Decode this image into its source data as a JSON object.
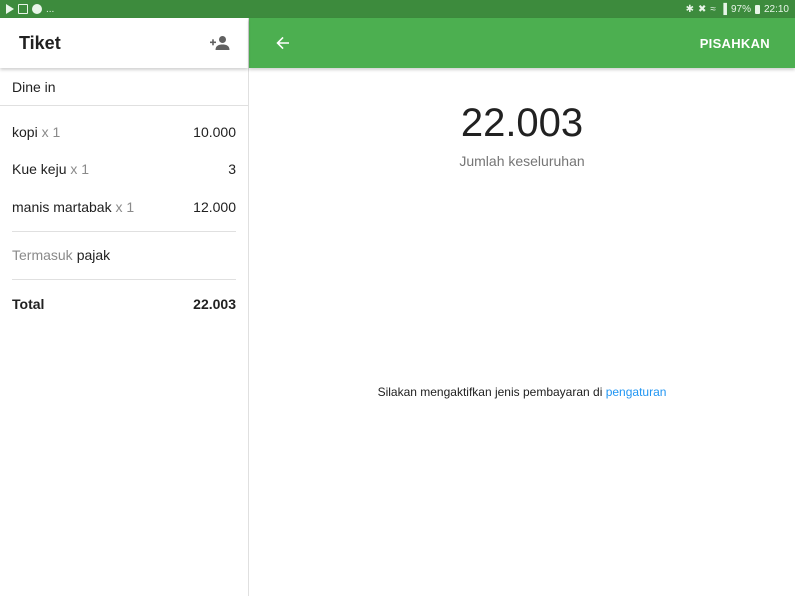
{
  "status_bar": {
    "left_more": "...",
    "battery": "97%",
    "time": "22:10"
  },
  "ticket": {
    "title": "Tiket",
    "dine_option": "Dine in",
    "items": [
      {
        "name": "kopi",
        "qty": "x 1",
        "price": "10.000"
      },
      {
        "name": "Kue keju",
        "qty": "x 1",
        "price": "3"
      },
      {
        "name": "manis martabak",
        "qty": "x 1",
        "price": "12.000"
      }
    ],
    "tax_prefix": "Termasuk",
    "tax_name": "pajak",
    "total_label": "Total",
    "total_value": "22.003"
  },
  "payment": {
    "split_label": "PISAHKAN",
    "amount": "22.003",
    "amount_label": "Jumlah keseluruhan",
    "notice_text": "Silakan mengaktifkan jenis pembayaran di",
    "notice_link": "pengaturan"
  },
  "colors": {
    "status_bar": "#3d8b3d",
    "toolbar": "#4caf50",
    "link": "#2196f3"
  },
  "icons": [
    "play-store-icon",
    "flipboard-icon",
    "skype-icon",
    "bluetooth-icon",
    "mute-icon",
    "wifi-icon",
    "signal-icon",
    "battery-icon",
    "add-person-icon",
    "back-arrow-icon"
  ]
}
